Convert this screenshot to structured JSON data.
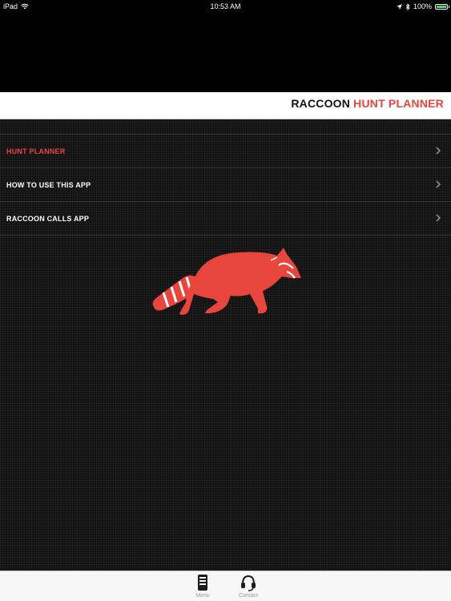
{
  "status_bar": {
    "device": "iPad",
    "time": "10:53 AM",
    "battery": "100%"
  },
  "header": {
    "title_part1": "RACCOON",
    "title_part2": "HUNT PLANNER"
  },
  "menu": {
    "items": [
      {
        "label": "HUNT PLANNER",
        "active": true
      },
      {
        "label": "HOW TO USE THIS APP",
        "active": false
      },
      {
        "label": "RACCOON CALLS APP",
        "active": false
      }
    ]
  },
  "tab_bar": {
    "tabs": [
      {
        "label": "Menu",
        "icon": "phone-menu-icon"
      },
      {
        "label": "Contact",
        "icon": "headset-icon"
      }
    ]
  },
  "colors": {
    "accent": "#e8453c",
    "background": "#111111",
    "title_band": "#ffffff"
  }
}
